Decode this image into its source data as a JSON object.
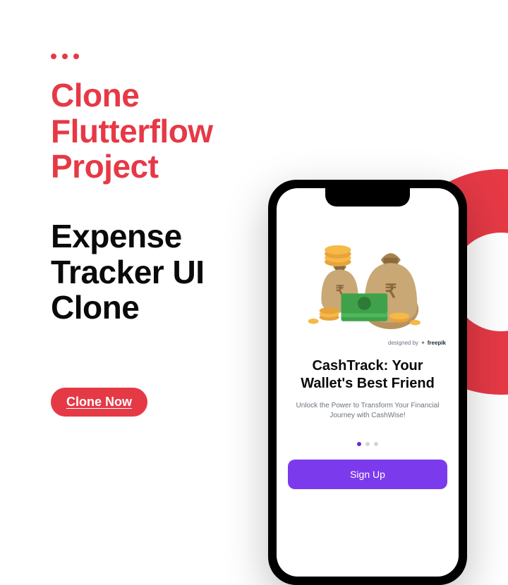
{
  "heading_red": "Clone\nFlutterflow\nProject",
  "heading_black": "Expense\nTracker UI\nClone",
  "cta_label": "Clone Now",
  "phone": {
    "credit_prefix": "designed by",
    "credit_brand": "freepik",
    "app_title": "CashTrack: Your Wallet's Best Friend",
    "app_subtitle": "Unlock the Power to Transform Your Financial Journey with CashWise!",
    "signup_label": "Sign Up"
  },
  "colors": {
    "accent": "#e63946",
    "purple": "#7c3aed"
  }
}
